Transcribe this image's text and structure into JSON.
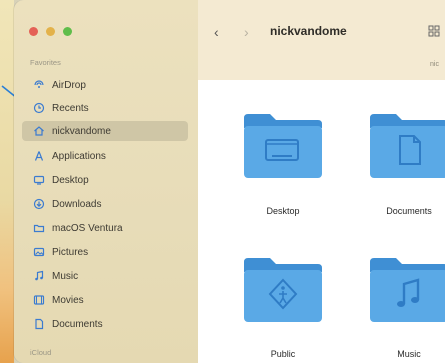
{
  "window": {
    "title": "nickvandome",
    "path_fragment": "nic"
  },
  "sidebar": {
    "section_favorites": "Favorites",
    "section_icloud": "iCloud",
    "items": [
      {
        "label": "AirDrop",
        "icon": "airdrop-icon"
      },
      {
        "label": "Recents",
        "icon": "clock-icon"
      },
      {
        "label": "nickvandome",
        "icon": "home-icon",
        "active": true
      },
      {
        "label": "Applications",
        "icon": "applications-icon"
      },
      {
        "label": "Desktop",
        "icon": "desktop-icon"
      },
      {
        "label": "Downloads",
        "icon": "download-icon"
      },
      {
        "label": "macOS Ventura",
        "icon": "folder-icon"
      },
      {
        "label": "Pictures",
        "icon": "pictures-icon"
      },
      {
        "label": "Music",
        "icon": "music-icon"
      },
      {
        "label": "Movies",
        "icon": "movies-icon"
      },
      {
        "label": "Documents",
        "icon": "document-icon"
      }
    ]
  },
  "content": {
    "folders": [
      {
        "label": "Desktop",
        "icon": "desktop-icon"
      },
      {
        "label": "Documents",
        "icon": "document-icon"
      },
      {
        "label": "Public",
        "icon": "public-icon"
      },
      {
        "label": "Music",
        "icon": "music-icon"
      }
    ]
  },
  "colors": {
    "folder_blue": "#5aa9e6",
    "folder_tab": "#3f8fd4",
    "accent": "#2a7fd6"
  }
}
